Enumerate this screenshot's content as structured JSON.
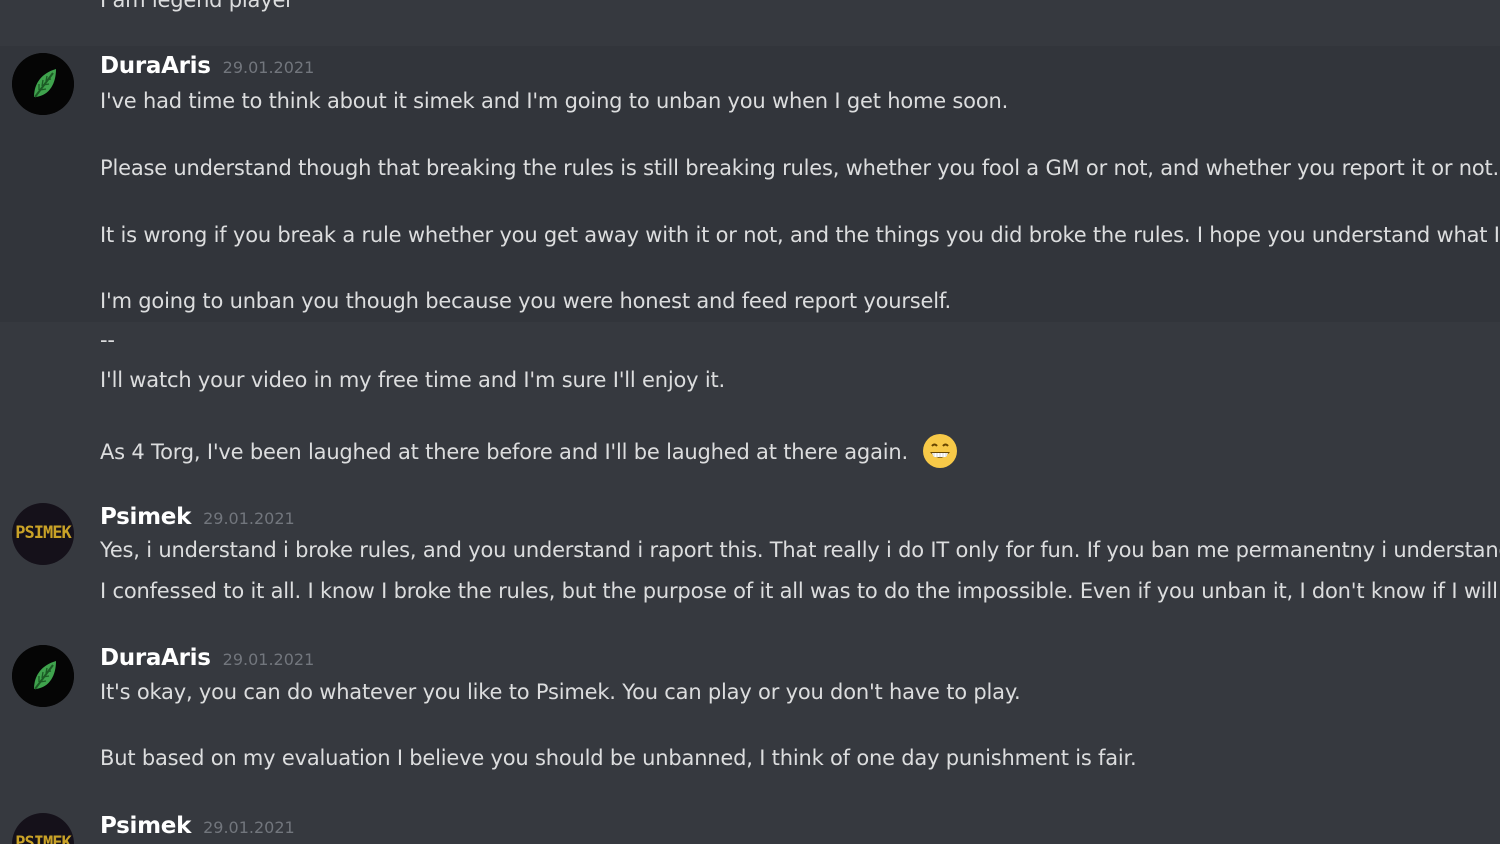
{
  "top_partial_text": "I am legend player",
  "messages": [
    {
      "author": "DuraAris",
      "timestamp": "29.01.2021",
      "avatar_icon": "leaf-icon",
      "lines": [
        "I've had time to think about it simek and I'm going to unban you when I get home soon.",
        "Please understand though that breaking the rules is still breaking rules, whether you fool a GM or not, and whether you report it or not.",
        "It is wrong if you break a rule whether you get away with it or not, and the things you did broke the rules. I hope you understand what I'm",
        "I'm going to unban you though because you were honest and feed report yourself.",
        "--",
        "I'll watch your video in my free time and I'm sure I'll enjoy it.",
        "As 4 Torg, I've been laughed at there before and I'll be laughed at there again."
      ],
      "emoji": "grinning-face-icon"
    },
    {
      "author": "Psimek",
      "timestamp": "29.01.2021",
      "avatar_text": "PSIMEK",
      "lines": [
        "Yes, i understand i broke rules, and you understand i raport this. That really i do IT only for fun. If you ban me permanentny i understand",
        "I confessed to it all. I know I broke the rules, but the purpose of it all was to do the impossible. Even if you unban it, I don't know if I will b"
      ]
    },
    {
      "author": "DuraAris",
      "timestamp": "29.01.2021",
      "avatar_icon": "leaf-icon",
      "lines": [
        "It's okay, you can do whatever you like to Psimek. You can play or you don't have to play.",
        "But based on my evaluation I believe you should be unbanned, I think of one day punishment is fair."
      ]
    },
    {
      "author": "Psimek",
      "timestamp": "29.01.2021",
      "avatar_text": "PSIMEK",
      "lines": []
    }
  ],
  "colors": {
    "background": "#36393f",
    "hover_background": "#32353b",
    "text": "#dcddde",
    "author": "#ffffff",
    "timestamp": "#72767d",
    "leaf": "#3fa34d",
    "psimek_logo": "#c9a227"
  }
}
